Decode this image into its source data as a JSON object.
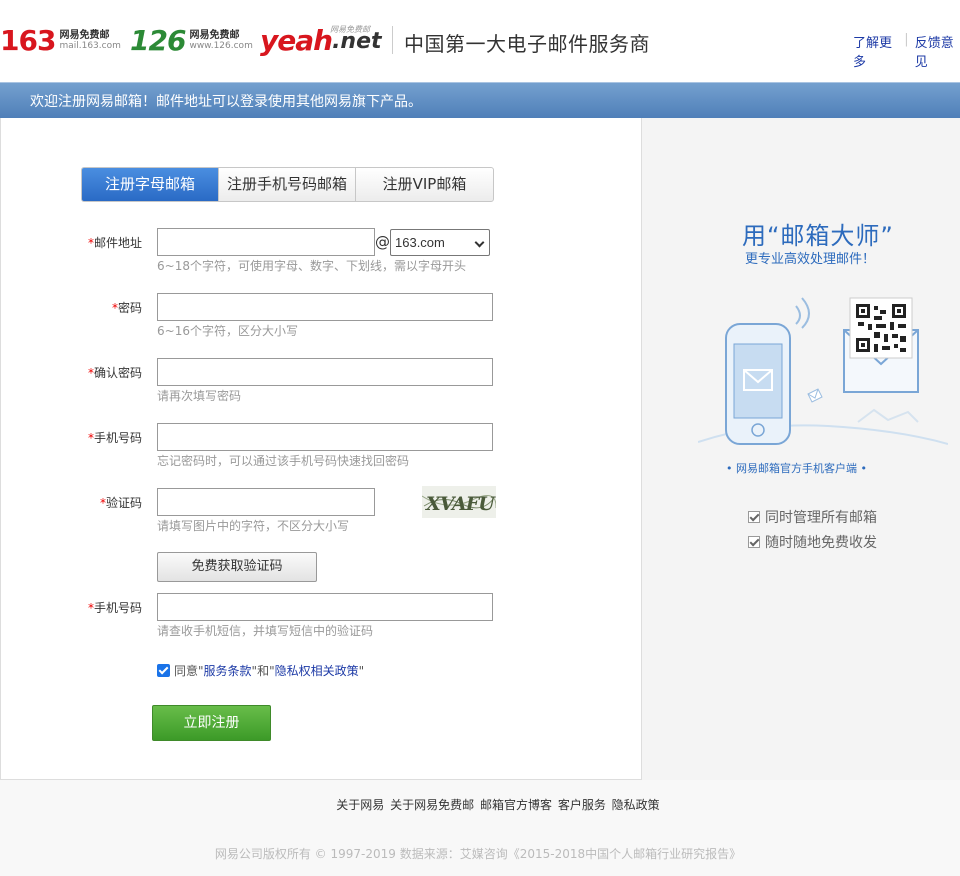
{
  "header": {
    "logo163": {
      "num": "163",
      "name": "网易免费邮",
      "domain": "mail.163.com"
    },
    "logo126": {
      "num": "126",
      "name": "网易免费邮",
      "domain": "www.126.com"
    },
    "logoyeah": {
      "yeah": "yeah",
      "net": ".net",
      "tag": "网易免费邮"
    },
    "slogan": "中国第一大电子邮件服务商",
    "links": [
      "了解更多",
      "反馈意见"
    ]
  },
  "banner": {
    "text": "欢迎注册网易邮箱！邮件地址可以登录使用其他网易旗下产品。"
  },
  "tabs": [
    {
      "label": "注册字母邮箱",
      "active": true
    },
    {
      "label": "注册手机号码邮箱",
      "active": false
    },
    {
      "label": "注册VIP邮箱",
      "active": false
    }
  ],
  "form": {
    "email": {
      "label": "邮件地址",
      "value": "",
      "hint": "6~18个字符，可使用字母、数字、下划线，需以字母开头",
      "at": "@",
      "domain": "163.com"
    },
    "password": {
      "label": "密码",
      "value": "",
      "hint": "6~16个字符，区分大小写"
    },
    "confirm": {
      "label": "确认密码",
      "value": "",
      "hint": "请再次填写密码"
    },
    "phone": {
      "label": "手机号码",
      "value": "",
      "hint": "忘记密码时，可以通过该手机号码快速找回密码"
    },
    "captcha": {
      "label": "验证码",
      "value": "",
      "hint": "请填写图片中的字符，不区分大小写",
      "image_text": "XVAFU"
    },
    "get_code_button": "免费获取验证码",
    "sms": {
      "label": "手机号码",
      "value": "",
      "hint": "请查收手机短信，并填写短信中的验证码"
    },
    "agree": {
      "checked": true,
      "prefix": "同意\"",
      "terms": "服务条款",
      "middle": "\"和\"",
      "privacy": "隐私权相关政策",
      "suffix": "\""
    },
    "submit": "立即注册",
    "required_mark": "*"
  },
  "side": {
    "title": "用“邮箱大师”",
    "subtitle": "更专业高效处理邮件！",
    "caption": "• 网易邮箱官方手机客户端 •",
    "features": [
      "同时管理所有邮箱",
      "随时随地免费收发"
    ]
  },
  "footer": {
    "links": [
      "关于网易",
      "关于网易免费邮",
      "邮箱官方博客",
      "客户服务",
      "隐私政策"
    ],
    "copyright": "网易公司版权所有 © 1997-2019  数据来源：艾媒咨询《2015-2018中国个人邮箱行业研究报告》"
  },
  "colors": {
    "accent_blue": "#2a6ac5",
    "banner_blue": "#5b8ac3",
    "brand_red": "#d8161e",
    "brand_green": "#2c8a36",
    "submit_green": "#4caa34",
    "link_blue": "#1d3aa6"
  }
}
